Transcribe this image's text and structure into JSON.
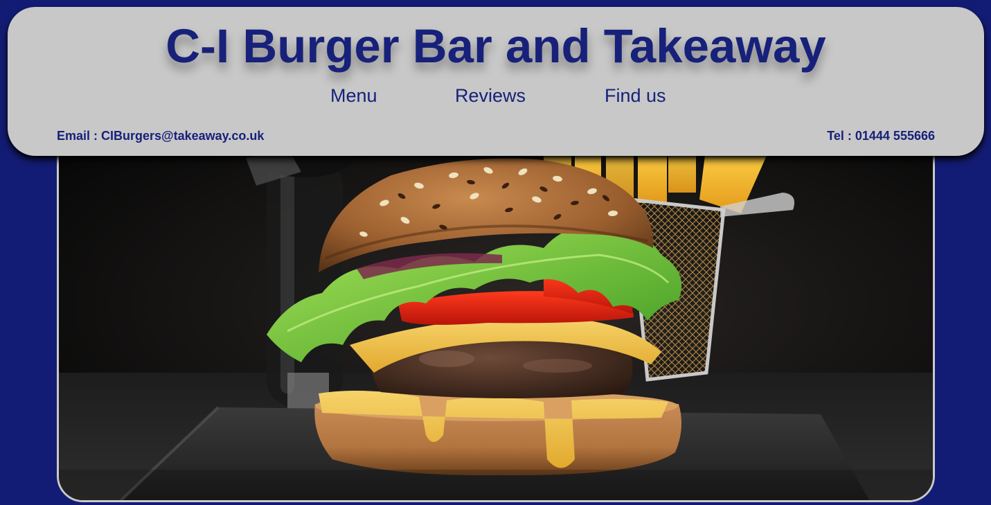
{
  "header": {
    "title": "C-I Burger Bar and Takeaway",
    "nav": {
      "menu": "Menu",
      "reviews": "Reviews",
      "find_us": "Find us"
    },
    "email_label": "Email : ",
    "email": "CIBurgers@takeaway.co.uk",
    "tel_label": "Tel : ",
    "tel": "01444 555666"
  },
  "hero": {
    "image": "burger-photo"
  },
  "colors": {
    "page_background": "#131c74",
    "header_background": "#c8c8c8",
    "brand_text": "#17217a",
    "frame_border": "#c9c9c9"
  }
}
